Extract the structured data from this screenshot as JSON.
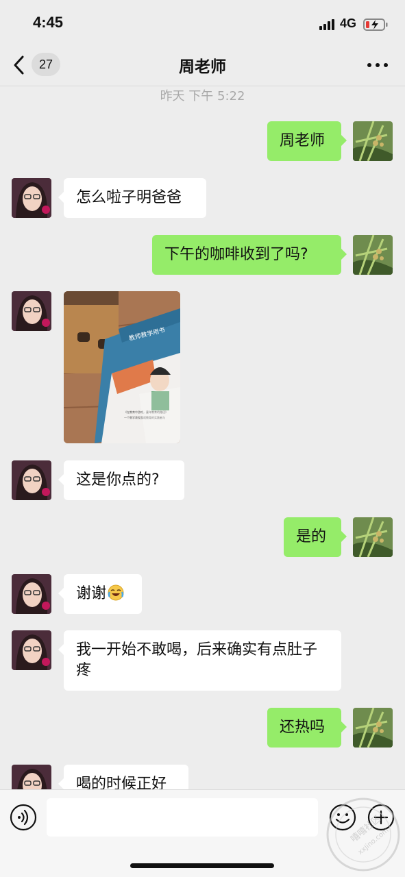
{
  "status_bar": {
    "time": "4:45",
    "network": "4G"
  },
  "nav": {
    "unread_count": "27",
    "title": "周老师"
  },
  "time_separator": "昨天 下午 5:22",
  "messages": [
    {
      "side": "out",
      "text": "周老师"
    },
    {
      "side": "in",
      "text": "怎么啦子明爸爸"
    },
    {
      "side": "out",
      "text": "下午的咖啡收到了吗?"
    },
    {
      "side": "in",
      "type": "image",
      "image_texts": {
        "book_title": "教师教学用书",
        "caption_1": "《在教育中游戏，童年教育的路径》",
        "caption_2": "一个教学表现游戏教育的实践者与"
      }
    },
    {
      "side": "in",
      "text": "这是你点的?"
    },
    {
      "side": "out",
      "text": "是的"
    },
    {
      "side": "in",
      "text": "谢谢",
      "emoji": "laughing-crying-emoji"
    },
    {
      "side": "in",
      "text": "我一开始不敢喝，后来确实有点肚子疼"
    },
    {
      "side": "out",
      "text": "还热吗"
    },
    {
      "side": "in",
      "text": "喝的时候正好"
    }
  ],
  "input_bar": {
    "placeholder": ""
  },
  "watermark": {
    "text_1": "嘻嘻社区",
    "text_2": "xxjino.com"
  },
  "colors": {
    "background": "#ededed",
    "outgoing_bubble": "#95ec69",
    "incoming_bubble": "#ffffff"
  }
}
